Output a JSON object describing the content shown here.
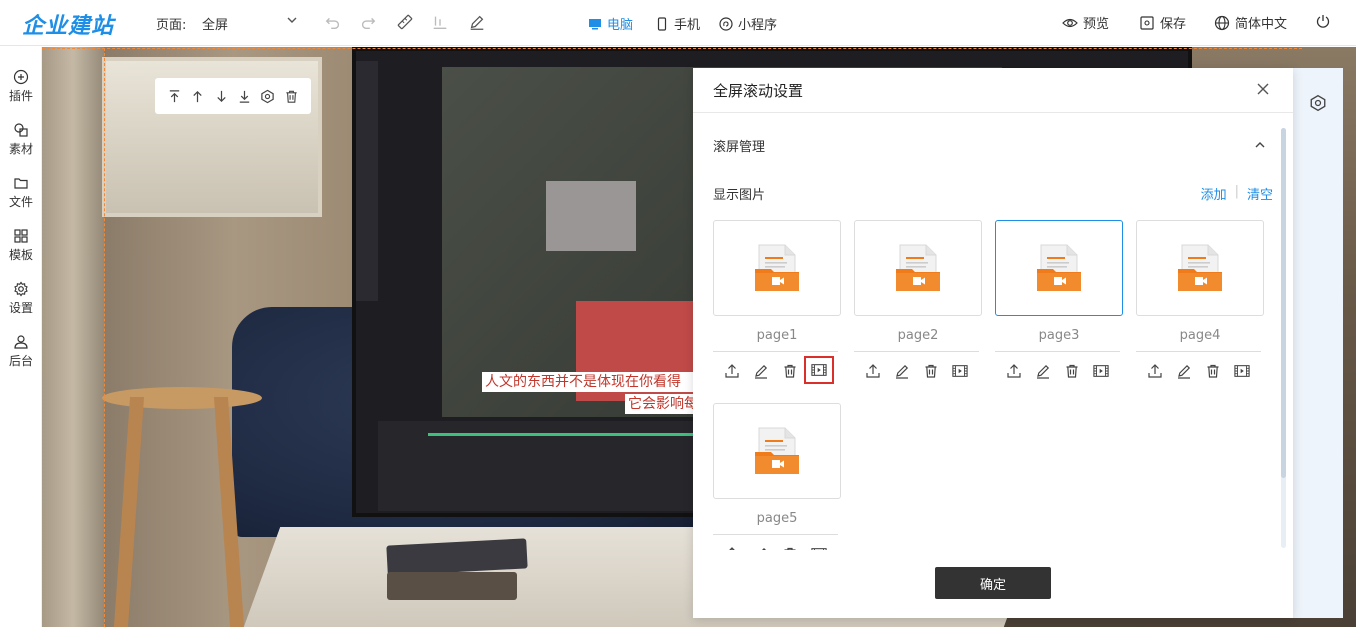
{
  "header": {
    "logo": "企业建站",
    "page_label": "页面:",
    "page_value": "全屏",
    "devices": [
      {
        "label": "电脑",
        "active": true
      },
      {
        "label": "手机",
        "active": false
      },
      {
        "label": "小程序",
        "active": false
      }
    ],
    "preview_label": "预览",
    "save_label": "保存",
    "language_label": "简体中文"
  },
  "sidebar": {
    "items": [
      {
        "label": "插件",
        "icon": "plus-circle-icon"
      },
      {
        "label": "素材",
        "icon": "material-icon"
      },
      {
        "label": "文件",
        "icon": "folder-icon"
      },
      {
        "label": "模板",
        "icon": "grid-icon"
      },
      {
        "label": "设置",
        "icon": "gear-icon"
      },
      {
        "label": "后台",
        "icon": "user-icon"
      }
    ]
  },
  "canvas": {
    "marquee_line1": "人文的东西并不是体现在你看得",
    "marquee_line2": "它会影响每"
  },
  "dialog": {
    "title": "全屏滚动设置",
    "section_title": "滚屏管理",
    "sub_title": "显示图片",
    "add_link": "添加",
    "clear_link": "清空",
    "link_separator": "|",
    "pages": [
      {
        "name": "page1",
        "selected": false
      },
      {
        "name": "page2",
        "selected": false
      },
      {
        "name": "page3",
        "selected": true
      },
      {
        "name": "page4",
        "selected": false
      },
      {
        "name": "page5",
        "selected": false
      }
    ],
    "confirm_label": "确定"
  },
  "colors": {
    "accent": "#1e8ee6",
    "highlight_border": "#d9302b",
    "dashed_guide": "#f08a3a",
    "confirm_bg": "#333333",
    "file_icon_orange": "#f07b1a"
  }
}
